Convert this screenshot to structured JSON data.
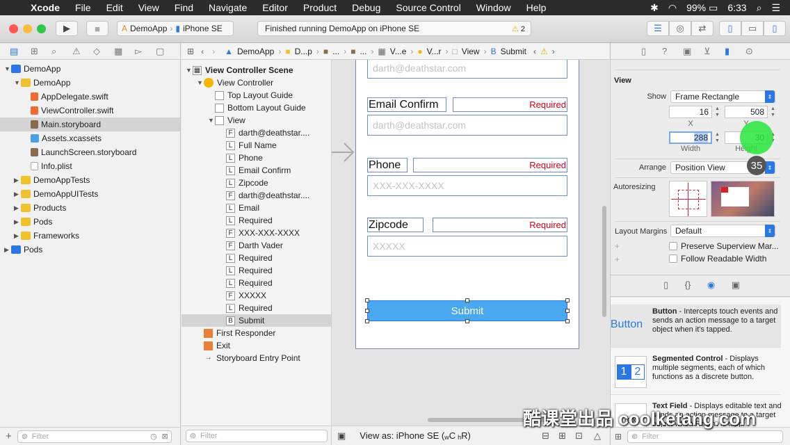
{
  "menubar": {
    "apple_glyph": "",
    "app": "Xcode",
    "items": [
      "File",
      "Edit",
      "View",
      "Find",
      "Navigate",
      "Editor",
      "Product",
      "Debug",
      "Source Control",
      "Window",
      "Help"
    ],
    "battery": "99%",
    "time": "6:33"
  },
  "toolbar": {
    "scheme_app": "DemoApp",
    "scheme_device": "iPhone SE",
    "status_text": "Finished running DemoApp on iPhone SE",
    "warning_count": "2"
  },
  "navigator": {
    "items": [
      {
        "label": "DemoApp",
        "indent": 0,
        "tri": "▼",
        "icon": "proj"
      },
      {
        "label": "DemoApp",
        "indent": 1,
        "tri": "▼",
        "icon": "folder"
      },
      {
        "label": "AppDelegate.swift",
        "indent": 2,
        "tri": "",
        "icon": "swift"
      },
      {
        "label": "ViewController.swift",
        "indent": 2,
        "tri": "",
        "icon": "swift"
      },
      {
        "label": "Main.storyboard",
        "indent": 2,
        "tri": "",
        "icon": "story",
        "selected": true
      },
      {
        "label": "Assets.xcassets",
        "indent": 2,
        "tri": "",
        "icon": "assets"
      },
      {
        "label": "LaunchScreen.storyboard",
        "indent": 2,
        "tri": "",
        "icon": "story"
      },
      {
        "label": "Info.plist",
        "indent": 2,
        "tri": "",
        "icon": "file"
      },
      {
        "label": "DemoAppTests",
        "indent": 1,
        "tri": "▶",
        "icon": "folder"
      },
      {
        "label": "DemoAppUITests",
        "indent": 1,
        "tri": "▶",
        "icon": "folder"
      },
      {
        "label": "Products",
        "indent": 1,
        "tri": "▶",
        "icon": "folder"
      },
      {
        "label": "Pods",
        "indent": 1,
        "tri": "▶",
        "icon": "folder"
      },
      {
        "label": "Frameworks",
        "indent": 1,
        "tri": "▶",
        "icon": "folder"
      },
      {
        "label": "Pods",
        "indent": 0,
        "tri": "▶",
        "icon": "proj"
      }
    ],
    "filter_placeholder": "Filter"
  },
  "jumpbar": [
    "DemoApp",
    "D...p",
    "...",
    "...",
    "V...e",
    "V...r",
    "View",
    "Submit"
  ],
  "outline": {
    "items": [
      {
        "label": "View Controller Scene",
        "indent": 0,
        "tri": "▼",
        "badge": "▦",
        "bold": true
      },
      {
        "label": "View Controller",
        "indent": 1,
        "tri": "▼",
        "badge": "vc"
      },
      {
        "label": "Top Layout Guide",
        "indent": 2,
        "tri": "",
        "badge": ""
      },
      {
        "label": "Bottom Layout Guide",
        "indent": 2,
        "tri": "",
        "badge": ""
      },
      {
        "label": "View",
        "indent": 2,
        "tri": "▼",
        "badge": ""
      },
      {
        "label": "darth@deathstar....",
        "indent": 3,
        "tri": "",
        "badge": "F"
      },
      {
        "label": "Full Name",
        "indent": 3,
        "tri": "",
        "badge": "L"
      },
      {
        "label": "Phone",
        "indent": 3,
        "tri": "",
        "badge": "L"
      },
      {
        "label": "Email Confirm",
        "indent": 3,
        "tri": "",
        "badge": "L"
      },
      {
        "label": "Zipcode",
        "indent": 3,
        "tri": "",
        "badge": "L"
      },
      {
        "label": "darth@deathstar....",
        "indent": 3,
        "tri": "",
        "badge": "F"
      },
      {
        "label": "Email",
        "indent": 3,
        "tri": "",
        "badge": "L"
      },
      {
        "label": "Required",
        "indent": 3,
        "tri": "",
        "badge": "L"
      },
      {
        "label": "XXX-XXX-XXXX",
        "indent": 3,
        "tri": "",
        "badge": "F"
      },
      {
        "label": "Darth Vader",
        "indent": 3,
        "tri": "",
        "badge": "F"
      },
      {
        "label": "Required",
        "indent": 3,
        "tri": "",
        "badge": "L"
      },
      {
        "label": "Required",
        "indent": 3,
        "tri": "",
        "badge": "L"
      },
      {
        "label": "Required",
        "indent": 3,
        "tri": "",
        "badge": "L"
      },
      {
        "label": "XXXXX",
        "indent": 3,
        "tri": "",
        "badge": "F"
      },
      {
        "label": "Required",
        "indent": 3,
        "tri": "",
        "badge": "L"
      },
      {
        "label": "Submit",
        "indent": 3,
        "tri": "",
        "badge": "B",
        "selected": true
      },
      {
        "label": "First Responder",
        "indent": 1,
        "tri": "",
        "badge": "fr"
      },
      {
        "label": "Exit",
        "indent": 1,
        "tri": "",
        "badge": "fr"
      },
      {
        "label": "Storyboard Entry Point",
        "indent": 1,
        "tri": "",
        "badge": "→"
      }
    ],
    "filter_placeholder": "Filter"
  },
  "canvas": {
    "email_placeholder": "darth@deathstar.com",
    "email_confirm_label": "Email Confirm",
    "email_confirm_required": "Required",
    "email_confirm_placeholder": "darth@deathstar.com",
    "phone_label": "Phone",
    "phone_required": "Required",
    "phone_placeholder": "XXX-XXX-XXXX",
    "zipcode_label": "Zipcode",
    "zipcode_required": "Required",
    "zipcode_placeholder": "XXXXX",
    "submit_label": "Submit",
    "view_as": "View as: iPhone SE (",
    "view_as_w": "w",
    "view_as_c": "C",
    "view_as_h": "h",
    "view_as_r": "R)"
  },
  "inspector": {
    "section": "View",
    "show_label": "Show",
    "show_value": "Frame Rectangle",
    "x_value": "16",
    "y_value": "508",
    "x_caption": "X",
    "y_caption": "Y",
    "width_value": "288",
    "height_value": "30",
    "width_caption": "Width",
    "height_caption": "Height",
    "arrange_label": "Arrange",
    "arrange_value": "Position View",
    "autoresizing_label": "Autoresizing",
    "layout_margins_label": "Layout Margins",
    "layout_margins_value": "Default",
    "preserve_label": "Preserve Superview Mar...",
    "readable_label": "Follow Readable Width",
    "library": [
      {
        "icon": "Button",
        "title": "Button",
        "desc": " - Intercepts touch events and sends an action message to a target object when it's tapped."
      },
      {
        "icon": "12",
        "title": "Segmented Control",
        "desc": " - Displays multiple segments, each of which functions as a discrete button."
      },
      {
        "icon": "Text",
        "title": "Text Field",
        "desc": " - Displays editable text and sends an action message to a target object when Return is tapp..."
      }
    ],
    "filter_placeholder": "Filter"
  },
  "overlay": {
    "touch_count": "35",
    "watermark": "酷课堂出品 coolketang.com"
  }
}
